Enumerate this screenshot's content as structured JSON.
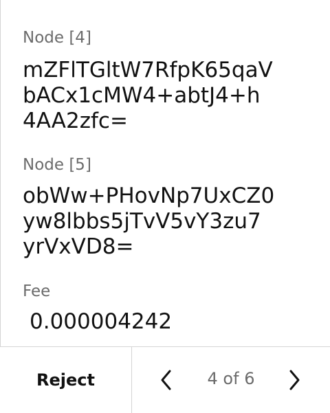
{
  "items": [
    {
      "label": "Node [4]",
      "value": "mZFlTGltW7RfpK65qaV\nbACx1cMW4+abtJ4+h\n4AA2zfc="
    },
    {
      "label": "Node [5]",
      "value": "obWw+PHovNp7UxCZ0\nyw8lbbs5jTvV5vY3zu7\nyrVxVD8="
    },
    {
      "label": "Fee",
      "value": "0.000004242"
    }
  ],
  "footer": {
    "reject_label": "Reject",
    "page_indicator": "4 of 6",
    "prev_icon": "chevron-left-icon",
    "next_icon": "chevron-right-icon"
  }
}
